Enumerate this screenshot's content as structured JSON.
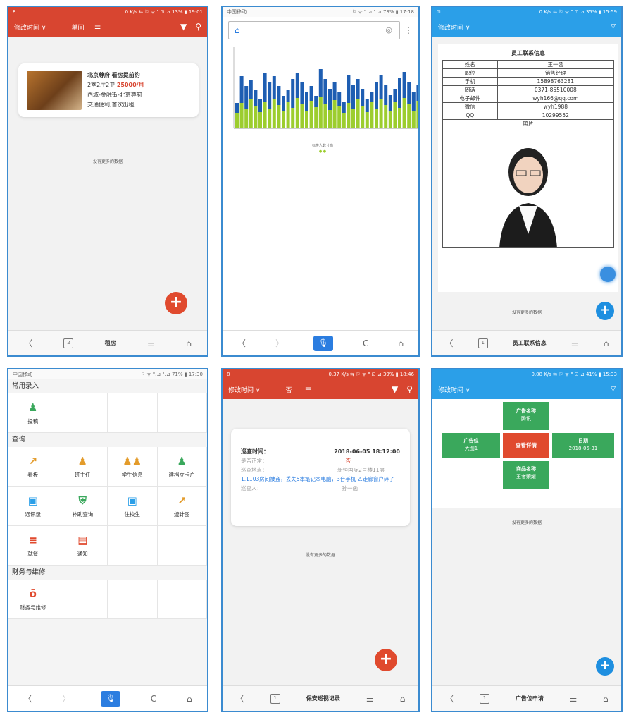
{
  "colors": {
    "red": "#d84530",
    "blue": "#2b9fe8",
    "green": "#3aa85c",
    "bar_green": "#9ccd2e",
    "bar_blue": "#1e5eb2"
  },
  "p1": {
    "status_left": "8",
    "status_right": "0 K/s ⇆ ⚐ ᯤ \" ⊡ ⊿ 13% ▮ 19:01",
    "sort_label": "修改时间 ∨",
    "filter_label": "单间",
    "listing": {
      "title": "北京尊府 看房提前约",
      "layout": "2室2厅2卫",
      "price": "25000/月",
      "area": "西城-金融街-北京尊府",
      "traffic": "交通便利,首次出租"
    },
    "nomore": "没有更多的数据",
    "nav_title": "租房"
  },
  "p2": {
    "status_left": "中国移动",
    "status_right": "⚐ ᯤ \".⊿ \".⊿ 73% ▮ 17:18",
    "axis_title": "标签人数分布",
    "legend": "● ●"
  },
  "p3": {
    "status_left": "⊡",
    "status_right": "0 K/s ⇆ ⚐ ᯤ \" ⊡ ⊿ 35% ▮ 15:59",
    "sort_label": "修改时间 ∨",
    "filter_icon": "▽",
    "card_title": "员工联系信息",
    "rows": [
      {
        "k": "姓名",
        "v": "王一函"
      },
      {
        "k": "职位",
        "v": "销售经理"
      },
      {
        "k": "手机",
        "v": "15898763281"
      },
      {
        "k": "固话",
        "v": "0371-85510008"
      },
      {
        "k": "电子邮件",
        "v": "wyh166@qq.com"
      },
      {
        "k": "微信",
        "v": "wyh1988"
      },
      {
        "k": "QQ",
        "v": "10299552"
      }
    ],
    "photo_label": "照片",
    "nomore": "没有更多的数据",
    "nav_title": "员工联系信息"
  },
  "p4": {
    "status_left": "中国移动",
    "status_right": "⚐ ᯤ \".⊿ \".⊿ 71% ▮ 17:30",
    "sec1": "常用录入",
    "sec1_items": [
      {
        "label": "投稿",
        "icon": "♟",
        "color": "#3aa85c"
      }
    ],
    "sec2": "查询",
    "sec2_items": [
      {
        "label": "看板",
        "icon": "↗",
        "color": "#e39b2a"
      },
      {
        "label": "班主任",
        "icon": "♟",
        "color": "#e39b2a"
      },
      {
        "label": "学生信息",
        "icon": "♟♟",
        "color": "#e39b2a"
      },
      {
        "label": "建档立卡户",
        "icon": "♟",
        "color": "#3aa85c"
      },
      {
        "label": "通讯录",
        "icon": "▣",
        "color": "#2b9fe8"
      },
      {
        "label": "补助查询",
        "icon": "⛨",
        "color": "#3aa85c"
      },
      {
        "label": "住校生",
        "icon": "▣",
        "color": "#2b9fe8"
      },
      {
        "label": "统计图",
        "icon": "↗",
        "color": "#e39b2a"
      },
      {
        "label": "就餐",
        "icon": "≡",
        "color": "#e04a2e"
      },
      {
        "label": "通知",
        "icon": "▤",
        "color": "#e04a2e"
      }
    ],
    "sec3": "财务与维修",
    "sec3_items": [
      {
        "label": "财务与维修",
        "icon": "ō",
        "color": "#e04a2e"
      }
    ]
  },
  "p5": {
    "status_left": "8",
    "status_right": "0.37 K/s ⇆ ⚐ ᯤ \" ⊡ ⊿ 39% ▮ 18:46",
    "sort_label": "修改时间 ∨",
    "filter_label": "否",
    "rec": {
      "time_k": "巡查时间：",
      "time_v": "2018-06-05 18:12:00",
      "safe_k": "是否正常：",
      "safe_v": "否",
      "place_k": "巡查地点：",
      "place_v": "新恒国际2号楼11层",
      "issue": "1.1103房间被盗，丢失5本笔记本电脑，3台手机 2.走廊窗户碎了",
      "person_k": "巡查人：",
      "person_v": "孙一函"
    },
    "nomore": "没有更多的数据",
    "nav_title": "保安巡视记录"
  },
  "p6": {
    "status_left": "",
    "status_right": "0.08 K/s ⇆ ⚐ ᯤ \" ⊡ ⊿ 41% ▮ 15:33",
    "sort_label": "修改时间 ∨",
    "filter_icon": "▽",
    "ad_name_k": "广告名称",
    "ad_name_v": "腾讯",
    "slot_k": "广告位",
    "slot_v": "大图1",
    "center": "查看详情",
    "date_k": "日期",
    "date_v": "2018-05-31",
    "prod_k": "商品名称",
    "prod_v": "王者荣耀",
    "nomore": "没有更多的数据",
    "nav_title": "广告位申请"
  }
}
